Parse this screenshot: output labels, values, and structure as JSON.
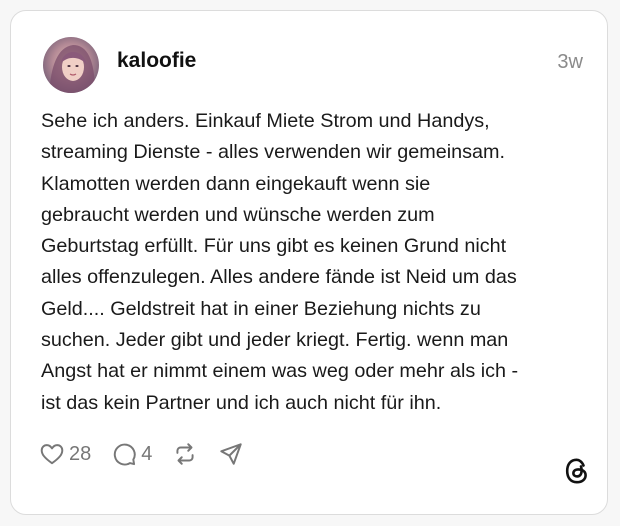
{
  "post": {
    "username": "kaloofie",
    "time": "3w",
    "lines": [
      "Sehe ich anders. Einkauf Miete Strom und Handys,",
      "streaming Dienste - alles verwenden wir gemeinsam.",
      "Klamotten werden dann eingekauft wenn sie",
      "gebraucht werden und wünsche werden zum",
      "Geburtstag erfüllt. Für uns gibt es keinen Grund nicht",
      "alles offenzulegen. Alles andere fände ist Neid um das",
      "Geld.... Geldstreit hat in einer Beziehung nichts zu",
      "suchen. Jeder gibt und jeder kriegt. Fertig. wenn man",
      "Angst hat er nimmt einem was weg oder mehr als ich -",
      "ist das kein Partner und ich auch nicht für ihn."
    ],
    "likes": "28",
    "replies": "4"
  },
  "icons": {
    "like": "heart-icon",
    "reply": "comment-icon",
    "repost": "repost-icon",
    "share": "send-icon",
    "brand": "threads-logo-icon"
  },
  "colors": {
    "text": "#1a1a1a",
    "muted": "#777777",
    "border": "#dcdcdc"
  }
}
